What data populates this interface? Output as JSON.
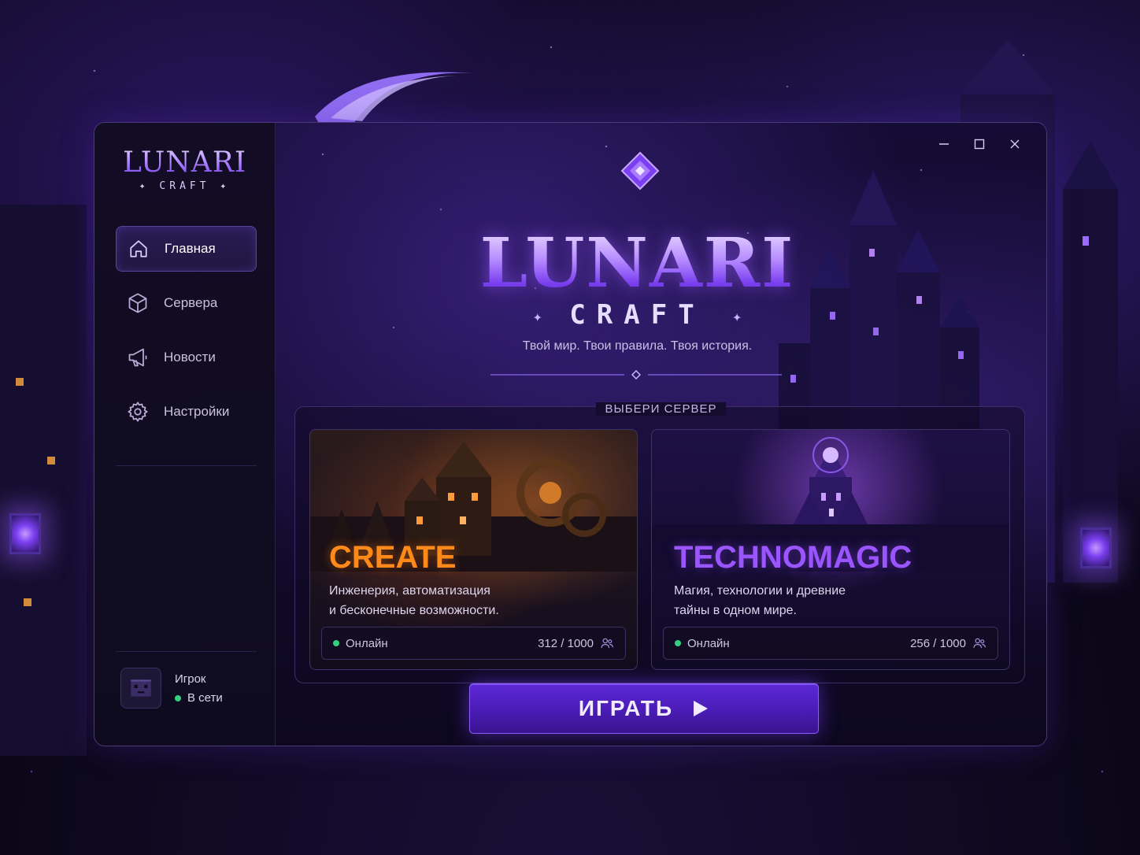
{
  "app": {
    "logo_title": "LUNARI",
    "logo_subtitle": "✦ CRAFT ✦",
    "accent_color": "#7a3ff0"
  },
  "sidebar": {
    "items": [
      {
        "label": "Главная",
        "icon": "home-icon",
        "active": true
      },
      {
        "label": "Сервера",
        "icon": "cube-icon",
        "active": false
      },
      {
        "label": "Новости",
        "icon": "megaphone-icon",
        "active": false
      },
      {
        "label": "Настройки",
        "icon": "gear-icon",
        "active": false
      }
    ],
    "profile": {
      "name": "Игрок",
      "status": "В сети",
      "status_color": "#35d07f"
    }
  },
  "window_controls": {
    "minimize_icon": "minimize-icon",
    "maximize_icon": "maximize-icon",
    "close_icon": "close-icon"
  },
  "hero": {
    "title": "LUNARI",
    "subtitle": "CRAFT",
    "tagline": "Твой мир. Твои правила. Твоя история."
  },
  "servers": {
    "section_label": "ВЫБЕРИ СЕРВЕР",
    "cards": [
      {
        "title": "CREATE",
        "description_line1": "Инженерия, автоматизация",
        "description_line2": "и бесконечные возможности.",
        "status": "Онлайн",
        "players": "312 / 1000",
        "title_color": "#ff8a1a"
      },
      {
        "title": "TECHNOMAGIC",
        "description_line1": "Магия, технологии и древние",
        "description_line2": "тайны в одном мире.",
        "status": "Онлайн",
        "players": "256 / 1000",
        "title_color": "#9b55ff"
      }
    ]
  },
  "play_button": {
    "label": "ИГРАТЬ"
  }
}
